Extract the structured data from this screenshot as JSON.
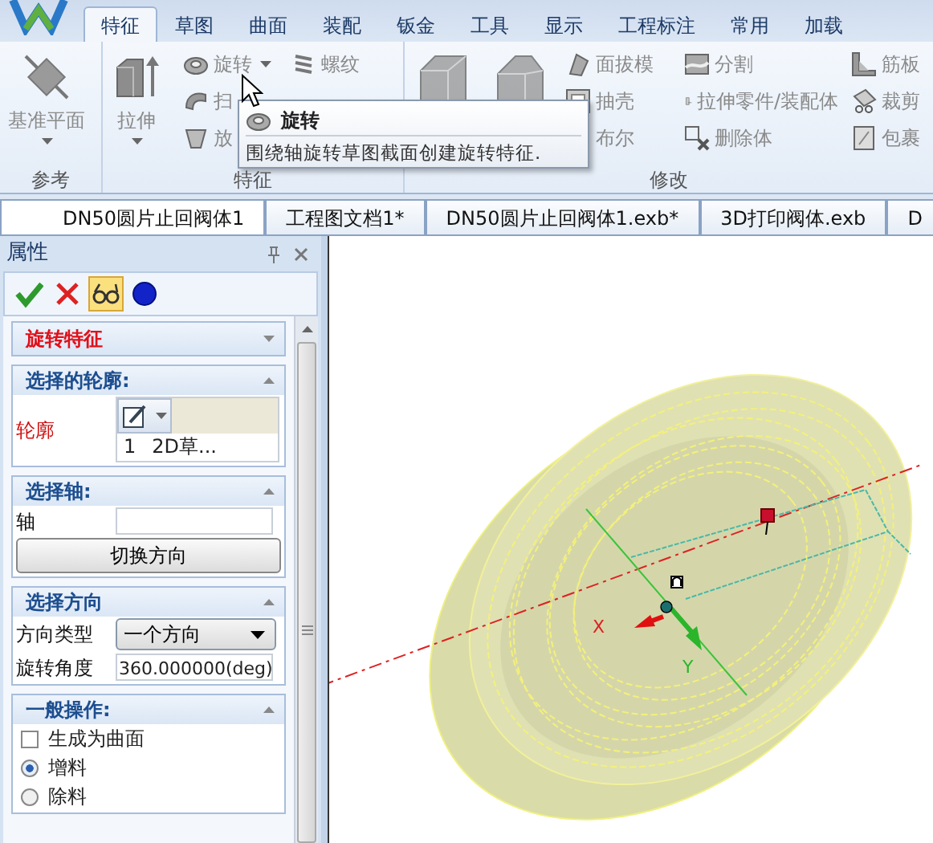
{
  "app_tabs": [
    {
      "label": "特征",
      "selected": true
    },
    {
      "label": "草图",
      "selected": false
    },
    {
      "label": "曲面",
      "selected": false
    },
    {
      "label": "装配",
      "selected": false
    },
    {
      "label": "钣金",
      "selected": false
    },
    {
      "label": "工具",
      "selected": false
    },
    {
      "label": "显示",
      "selected": false
    },
    {
      "label": "工程标注",
      "selected": false
    },
    {
      "label": "常用",
      "selected": false
    },
    {
      "label": "加载",
      "selected": false
    }
  ],
  "ribbon_groups": [
    {
      "label": "参考",
      "large": [
        {
          "label": "基准平面",
          "dropdown": true
        }
      ]
    },
    {
      "label": "特征",
      "large": [
        {
          "label": "拉伸",
          "dropdown": true
        }
      ],
      "columns": [
        [
          {
            "label": "旋转",
            "dropdown": true
          },
          {
            "label": "扫"
          },
          {
            "label": "放"
          }
        ],
        [
          {
            "label": "螺纹"
          }
        ]
      ]
    },
    {
      "label": "修改",
      "large": [
        {
          "disabled": true
        },
        {
          "disabled": true
        }
      ],
      "columns": [
        [
          {
            "label": "面拔模"
          },
          {
            "label": "抽壳"
          },
          {
            "label": "布尔"
          }
        ],
        [
          {
            "label": "分割"
          },
          {
            "label": "拉伸零件/装配体"
          },
          {
            "label": "删除体"
          }
        ],
        [
          {
            "label": "筋板"
          },
          {
            "label": "裁剪"
          },
          {
            "label": "包裹"
          }
        ]
      ]
    }
  ],
  "tooltip": {
    "title": "旋转",
    "text": "围绕轴旋转草图截面创建旋转特征."
  },
  "doc_tabs": [
    {
      "label": "DN50圆片止回阀体1",
      "selected": true
    },
    {
      "label": "工程图文档1*",
      "selected": false
    },
    {
      "label": "DN50圆片止回阀体1.exb*",
      "selected": false
    },
    {
      "label": "3D打印阀体.exb",
      "selected": false
    },
    {
      "label": "D",
      "selected": false
    }
  ],
  "panel": {
    "title": "属性",
    "toolbar": [
      {
        "kind": "ok"
      },
      {
        "kind": "cancel"
      },
      {
        "kind": "preview",
        "on": true
      },
      {
        "kind": "dot"
      }
    ],
    "sections": [
      {
        "title": "旋转特征",
        "kind": "feature",
        "expanded": false
      },
      {
        "title": "选择的轮廓:",
        "kind": "group",
        "expanded": true,
        "rows": [
          {
            "kind": "picker",
            "label": "轮廓",
            "required": true,
            "items": [
              {
                "index": "1",
                "text": "2D草..."
              }
            ]
          }
        ]
      },
      {
        "title": "选择轴:",
        "kind": "group",
        "expanded": true,
        "rows": [
          {
            "kind": "field",
            "label": "轴",
            "required": false
          },
          {
            "kind": "button",
            "label": "切换方向"
          }
        ]
      },
      {
        "title": "选择方向",
        "kind": "group",
        "expanded": true,
        "rows": [
          {
            "kind": "select",
            "label": "方向类型",
            "value": "一个方向",
            "required": false
          },
          {
            "kind": "field",
            "label": "旋转角度",
            "value": "360.000000(deg)",
            "required": false
          }
        ]
      },
      {
        "title": "一般操作:",
        "kind": "group",
        "expanded": true,
        "rows": [
          {
            "kind": "checkbox",
            "label": "生成为曲面",
            "checked": false
          },
          {
            "kind": "radio",
            "label": "增料",
            "selected": true
          },
          {
            "kind": "radio",
            "label": "除料",
            "selected": false
          }
        ]
      }
    ]
  },
  "viewport": {
    "axes": [
      {
        "kind": "x",
        "label": "X"
      },
      {
        "kind": "y",
        "label": "Y"
      }
    ]
  }
}
